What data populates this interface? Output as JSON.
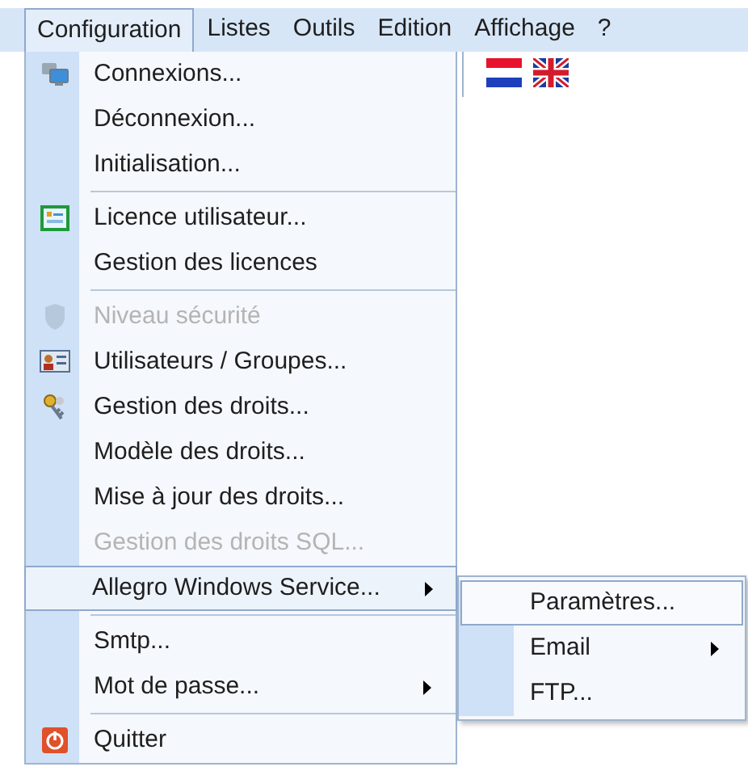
{
  "menu_bar": [
    {
      "label": "Configuration",
      "selected": true
    },
    {
      "label": "Listes",
      "selected": false
    },
    {
      "label": "Outils",
      "selected": false
    },
    {
      "label": "Edition",
      "selected": false
    },
    {
      "label": "Affichage",
      "selected": false
    },
    {
      "label": "?",
      "selected": false
    }
  ],
  "menu": [
    {
      "kind": "item",
      "label": "Connexions...",
      "disabled": false,
      "selected": false,
      "submenu": false
    },
    {
      "kind": "item",
      "label": "Déconnexion...",
      "disabled": false,
      "selected": false,
      "submenu": false
    },
    {
      "kind": "item",
      "label": "Initialisation...",
      "disabled": false,
      "selected": false,
      "submenu": false
    },
    {
      "kind": "separator"
    },
    {
      "kind": "item",
      "label": "Licence utilisateur...",
      "disabled": false,
      "selected": false,
      "submenu": false
    },
    {
      "kind": "item",
      "label": "Gestion des licences",
      "disabled": false,
      "selected": false,
      "submenu": false
    },
    {
      "kind": "separator"
    },
    {
      "kind": "item",
      "label": "Niveau sécurité",
      "disabled": true,
      "selected": false,
      "submenu": false
    },
    {
      "kind": "item",
      "label": "Utilisateurs / Groupes...",
      "disabled": false,
      "selected": false,
      "submenu": false
    },
    {
      "kind": "item",
      "label": "Gestion des droits...",
      "disabled": false,
      "selected": false,
      "submenu": false
    },
    {
      "kind": "item",
      "label": "Modèle des droits...",
      "disabled": false,
      "selected": false,
      "submenu": false
    },
    {
      "kind": "item",
      "label": "Mise à jour des droits...",
      "disabled": false,
      "selected": false,
      "submenu": false
    },
    {
      "kind": "item",
      "label": "Gestion des droits SQL...",
      "disabled": true,
      "selected": false,
      "submenu": false
    },
    {
      "kind": "item",
      "label": "Allegro Windows Service...",
      "disabled": false,
      "selected": true,
      "submenu": true
    },
    {
      "kind": "separator"
    },
    {
      "kind": "item",
      "label": "Smtp...",
      "disabled": false,
      "selected": false,
      "submenu": false
    },
    {
      "kind": "item",
      "label": "Mot de passe...",
      "disabled": false,
      "selected": false,
      "submenu": true
    },
    {
      "kind": "separator"
    },
    {
      "kind": "item",
      "label": "Quitter",
      "disabled": false,
      "selected": false,
      "submenu": false
    }
  ],
  "submenu": [
    {
      "label": "Paramètres...",
      "selected": true,
      "submenu": false
    },
    {
      "label": "Email",
      "selected": false,
      "submenu": true
    },
    {
      "label": "FTP...",
      "selected": false,
      "submenu": false
    }
  ]
}
